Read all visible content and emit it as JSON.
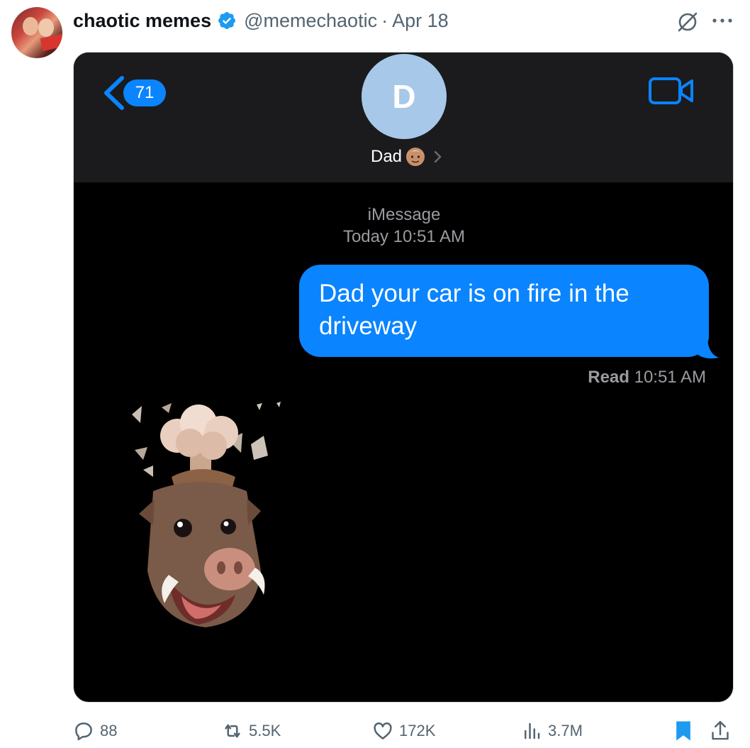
{
  "tweet": {
    "display_name": "chaotic memes",
    "handle": "@memechaotic",
    "separator": "·",
    "date": "Apr 18"
  },
  "imessage": {
    "unread_count": "71",
    "contact_initial": "D",
    "contact_name": "Dad",
    "service_label": "iMessage",
    "timestamp": "Today 10:51 AM",
    "message_text": "Dad your car is on fire in the driveway",
    "read_label": "Read",
    "read_time": "10:51 AM",
    "accent_color": "#0a84ff"
  },
  "actions": {
    "replies": "88",
    "reposts": "5.5K",
    "likes": "172K",
    "views": "3.7M"
  },
  "colors": {
    "verified_badge": "#1d9bf0",
    "bookmark_active": "#1d9bf0",
    "secondary_text": "#536471"
  }
}
